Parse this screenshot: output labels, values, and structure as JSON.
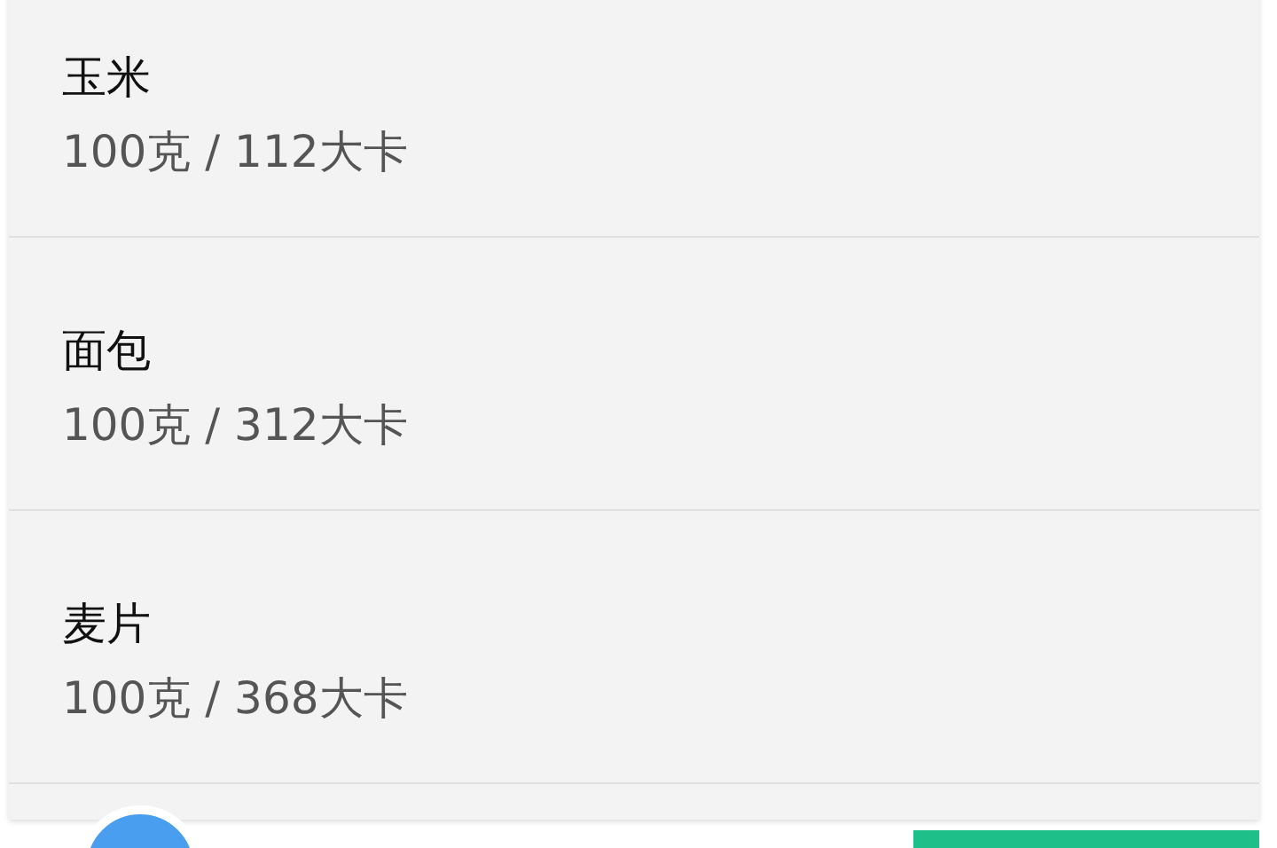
{
  "foods": [
    {
      "name": "玉米",
      "detail": "100克 / 112大卡"
    },
    {
      "name": "面包",
      "detail": "100克 / 312大卡"
    },
    {
      "name": "麦片",
      "detail": "100克 / 368大卡"
    }
  ]
}
